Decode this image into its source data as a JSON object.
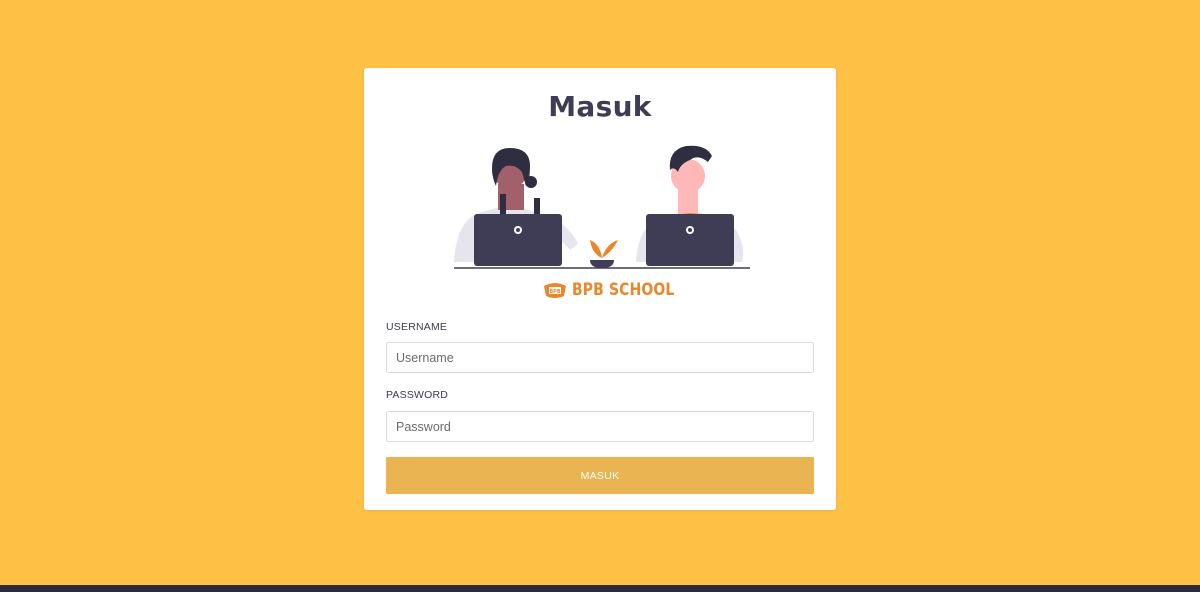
{
  "colors": {
    "background": "#FFC145",
    "title": "#3f3d56",
    "button": "#E9B451",
    "logo": "#e8872b"
  },
  "login": {
    "title": "Masuk",
    "logo_text": "BPB SCHOOL",
    "username_label": "USERNAME",
    "username_placeholder": "Username",
    "username_value": "",
    "password_label": "PASSWORD",
    "password_placeholder": "Password",
    "password_value": "",
    "submit_label": "MASUK"
  },
  "icons": {
    "illustration": "two-people-with-laptops-illustration",
    "logo": "bpb-school-crest-icon"
  }
}
